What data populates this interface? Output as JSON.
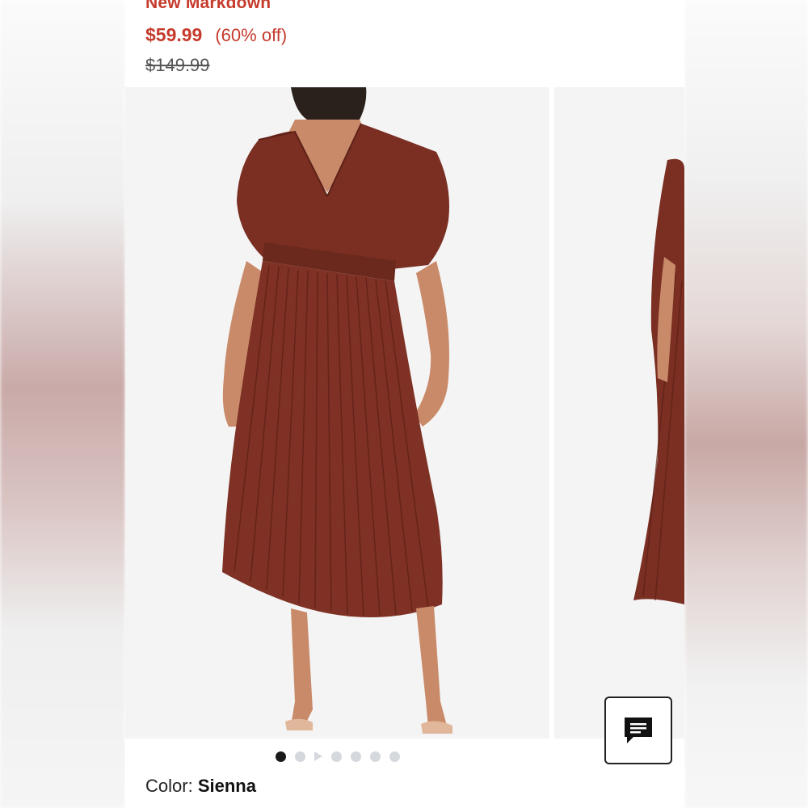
{
  "product": {
    "badge": "New Markdown",
    "sale_price": "$59.99",
    "discount": "(60% off)",
    "original_price": "$149.99",
    "color_label": "Color:",
    "color_value": "Sienna"
  },
  "gallery": {
    "image_alt": "Sienna pleated satin midi dress",
    "current_slide": 1,
    "slide_count": 7,
    "dress_color": "#7a2f22"
  },
  "icons": {
    "chat": "chat-icon",
    "play": "play-icon"
  },
  "colors": {
    "accent": "#c53b2c",
    "dot_active": "#1a1a1a",
    "dot_inactive": "#d5d9de"
  }
}
